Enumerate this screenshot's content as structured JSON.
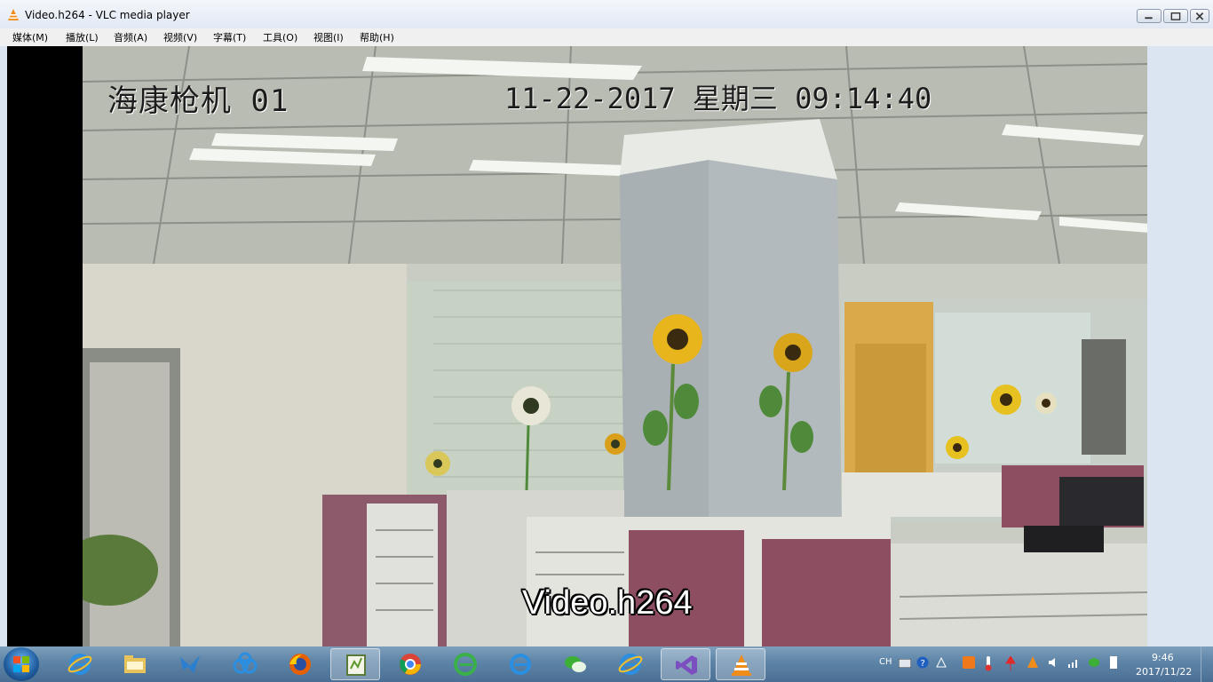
{
  "window": {
    "title": "Video.h264 - VLC media player"
  },
  "menubar": {
    "items": [
      {
        "label": "媒体(M)"
      },
      {
        "label": "播放(L)"
      },
      {
        "label": "音频(A)"
      },
      {
        "label": "视频(V)"
      },
      {
        "label": "字幕(T)"
      },
      {
        "label": "工具(O)"
      },
      {
        "label": "视图(I)"
      },
      {
        "label": "帮助(H)"
      }
    ]
  },
  "video": {
    "camera_label": "海康枪机 01",
    "timestamp": "11-22-2017 星期三 09:14:40",
    "filename_overlay": "Video.h264"
  },
  "taskbar": {
    "apps": [
      {
        "icon": "internet-explorer-icon"
      },
      {
        "icon": "file-explorer-icon"
      },
      {
        "icon": "bird-app-icon"
      },
      {
        "icon": "baidu-netdisk-icon"
      },
      {
        "icon": "firefox-icon"
      },
      {
        "icon": "notepad-plus-icon"
      },
      {
        "icon": "chrome-icon"
      },
      {
        "icon": "green-browser-icon"
      },
      {
        "icon": "internet-explorer-icon"
      },
      {
        "icon": "wechat-icon"
      },
      {
        "icon": "internet-explorer-icon"
      },
      {
        "icon": "visual-studio-icon"
      },
      {
        "icon": "vlc-icon"
      }
    ],
    "tray": {
      "language": "CH",
      "time": "9:46",
      "date": "2017/11/22"
    }
  },
  "colors": {
    "taskbar": "#5f85a8",
    "titlebar": "#e2e9f4",
    "vlc_orange": "#f08c1a"
  }
}
